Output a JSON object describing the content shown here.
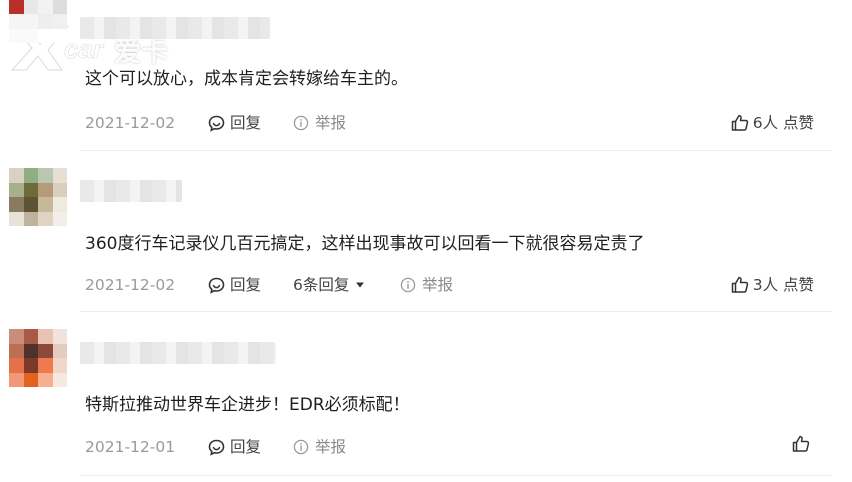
{
  "watermark": {
    "brand": "爱卡"
  },
  "comments": [
    {
      "text": "这个可以放心，成本肯定会转嫁给车主的。",
      "date": "2021-12-02",
      "reply_label": "回复",
      "report_label": "举报",
      "likes": "6人 点赞",
      "avatar_colors": [
        "#d63a2e",
        "#e05040",
        "#c9c9c9",
        "#f0d8d4",
        "#b83028",
        "#e8e8e8",
        "#f2f2f2",
        "#ddd",
        "#f5f5f5",
        "#f5f5f5",
        "#eee",
        "#f0f0f0",
        "#fafafa",
        "#fafafa",
        "#fff",
        "#fff"
      ]
    },
    {
      "text": "360度行车记录仪几百元搞定，这样出现事故可以回看一下就很容易定责了",
      "date": "2021-12-02",
      "replies_count": "6条回复",
      "report_label": "举报",
      "likes": "3人 点赞",
      "avatar_colors": [
        "#d9d2c0",
        "#8fae84",
        "#b9c6b0",
        "#e7dfd4",
        "#a7b08a",
        "#6e6a3a",
        "#b59a7c",
        "#d8cfbf",
        "#8a7a62",
        "#5e5236",
        "#c8b89a",
        "#efe9df",
        "#e8e2d7",
        "#bfb39b",
        "#ddd4c3",
        "#f3efe8"
      ]
    },
    {
      "text": "特斯拉推动世界车企进步！EDR必须标配！",
      "date": "2021-12-01",
      "reply_label": "回复",
      "report_label": "举报",
      "likes": "",
      "avatar_colors": [
        "#c98d79",
        "#a85a45",
        "#e8c2b2",
        "#f1e3dc",
        "#b97055",
        "#4e3128",
        "#8d4a3a",
        "#e3cbbf",
        "#e5704a",
        "#7a3a2c",
        "#f07a4e",
        "#f2d6c8",
        "#f29876",
        "#e2621e",
        "#f6b08f",
        "#f7e8df"
      ]
    }
  ]
}
